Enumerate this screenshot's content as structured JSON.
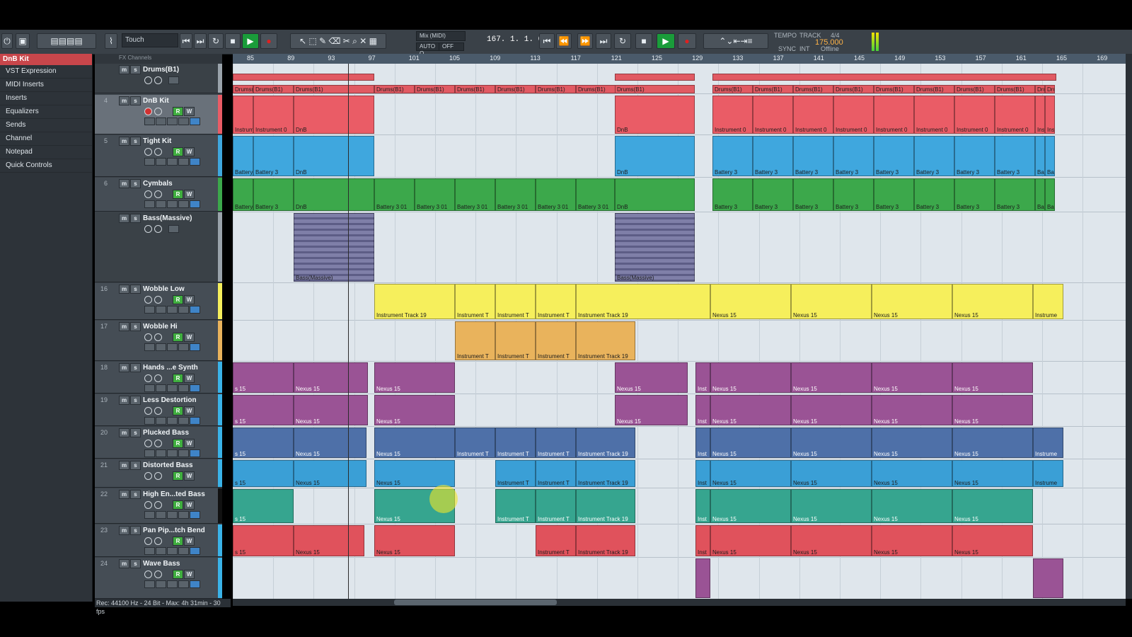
{
  "toolbar": {
    "automation_mode": "Touch",
    "mix_label": "Mix (MIDI)",
    "auto_q": "AUTO Q",
    "auto_q_value": "OFF",
    "position": "167. 1. 1. 0",
    "tempo_label": "TEMPO",
    "track_label": "TRACK",
    "signature": "4/4",
    "tempo_value": "175.000",
    "sync_label": "SYNC",
    "int_label": "INT",
    "offline_label": "Offline"
  },
  "inspector": {
    "title": "DnB Kit",
    "items": [
      "VST Expression",
      "MIDI Inserts",
      "Inserts",
      "Equalizers",
      "Sends",
      "Channel",
      "Notepad",
      "Quick Controls"
    ]
  },
  "tracklist_header": "FX Channels",
  "tracks": [
    {
      "num": "",
      "name": "Drums(B1)"
    },
    {
      "num": "4",
      "name": "DnB Kit"
    },
    {
      "num": "5",
      "name": "Tight Kit"
    },
    {
      "num": "6",
      "name": "Cymbals"
    },
    {
      "num": "",
      "name": "Bass(Massive)"
    },
    {
      "num": "16",
      "name": "Wobble Low"
    },
    {
      "num": "17",
      "name": "Wobble Hi"
    },
    {
      "num": "18",
      "name": "Hands ...e Synth"
    },
    {
      "num": "19",
      "name": "Less Destortion"
    },
    {
      "num": "20",
      "name": "Plucked Bass"
    },
    {
      "num": "21",
      "name": "Distorted Bass"
    },
    {
      "num": "22",
      "name": "High En...ted Bass"
    },
    {
      "num": "23",
      "name": "Pan Pip...tch Bend"
    },
    {
      "num": "24",
      "name": "Wave Bass"
    }
  ],
  "ruler": [
    "85",
    "89",
    "93",
    "97",
    "101",
    "105",
    "109",
    "113",
    "117",
    "121",
    "125",
    "129",
    "133",
    "137",
    "141",
    "145",
    "149",
    "153",
    "157",
    "161",
    "165",
    "169"
  ],
  "status": "Rec: 44100 Hz - 24 Bit - Max: 4h 31min - 30 fps",
  "clip_labels": {
    "drums": "Drums(B1)",
    "instrument0": "Instrument 0",
    "dnb": "DnB",
    "battery": "Battery 3",
    "battery301": "Battery 3 01",
    "bass_massive": "Bass(Massive)",
    "itrack19": "Instrument Track 19",
    "itrack": "Instrument T",
    "nexus": "Nexus 15",
    "s15": "s 15",
    "inst": "Inst",
    "instrume": "Instrume"
  },
  "colors": {
    "drums_bar": "#e15a63",
    "red_clip": "#ea5c66",
    "blue_clip": "#3fa7de",
    "green_clip": "#3ca84b",
    "gray_bass": "#7f7fa8",
    "yellow_clip": "#f6ef5c",
    "orange_clip": "#e9b35c",
    "purple_clip": "#9a5395",
    "slate_clip": "#4e70a8",
    "cyan_clip": "#3a9fd6",
    "teal_clip": "#36a58f",
    "pink_clip": "#e0525c"
  }
}
